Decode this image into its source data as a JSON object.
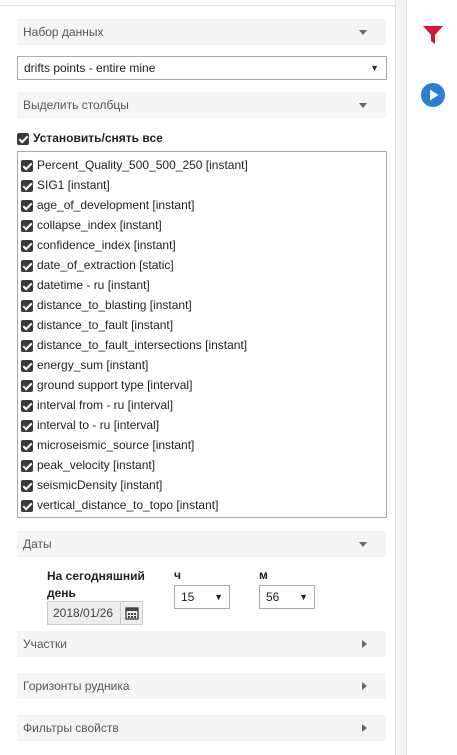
{
  "dataset": {
    "header": "Набор данных",
    "selected": "drifts points - entire mine"
  },
  "columns": {
    "header": "Выделить столбцы",
    "select_all_label": "Установить/снять все",
    "items": [
      "Percent_Quality_500_500_250 [instant]",
      "SIG1 [instant]",
      "age_of_development [instant]",
      "collapse_index [instant]",
      "confidence_index [instant]",
      "date_of_extraction [static]",
      "datetime - ru [instant]",
      "distance_to_blasting [instant]",
      "distance_to_fault [instant]",
      "distance_to_fault_intersections [instant]",
      "energy_sum [instant]",
      "ground support type [interval]",
      "interval from - ru [interval]",
      "interval to - ru [interval]",
      "microseismic_source [instant]",
      "peak_velocity [instant]",
      "seismicDensity [instant]",
      "vertical_distance_to_topo [instant]"
    ]
  },
  "dates": {
    "header": "Даты",
    "today_label": "На сегодняшний день",
    "date_value": "2018/01/26",
    "hour_label": "ч",
    "hour_value": "15",
    "minute_label": "м",
    "minute_value": "56"
  },
  "sections": {
    "areas": "Участки",
    "horizons": "Горизонты рудника",
    "property_filters": "Фильтры свойств"
  },
  "icons": {
    "filter_color": "#d9143a",
    "play_color": "#2a7fd4"
  }
}
